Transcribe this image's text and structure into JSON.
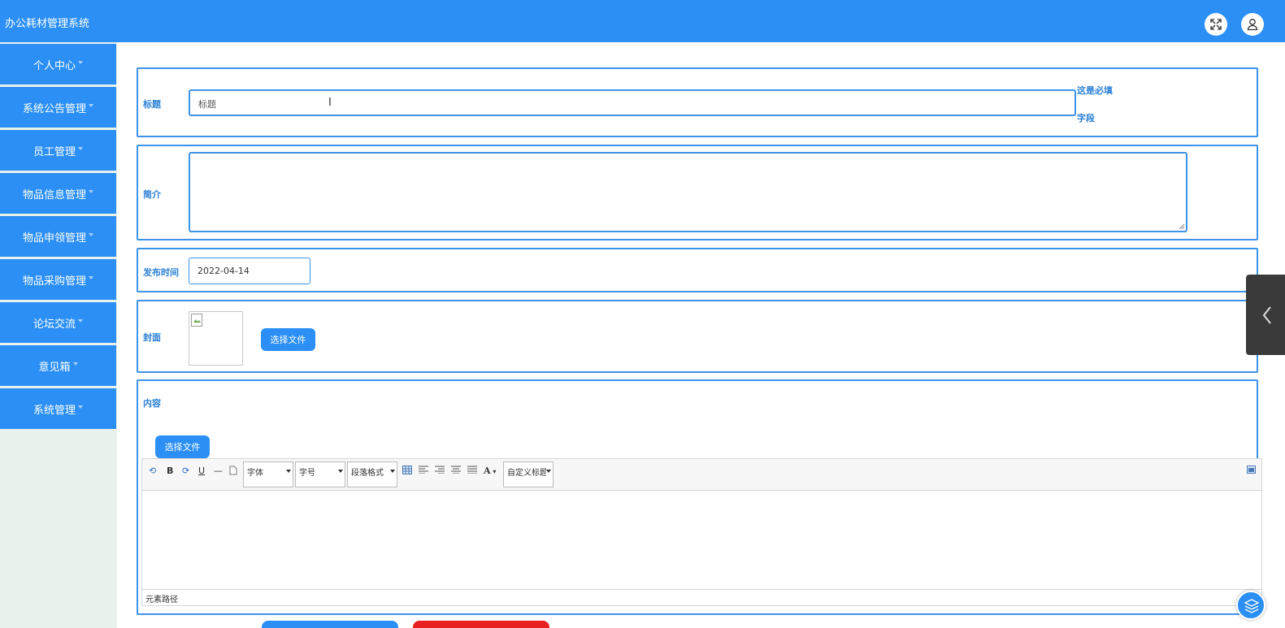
{
  "app": {
    "title": "办公耗材管理系统"
  },
  "header": {
    "fullscreen_icon": "expand-icon",
    "user_icon": "user-icon"
  },
  "sidebar": {
    "items": [
      {
        "label": "个人中心"
      },
      {
        "label": "系统公告管理"
      },
      {
        "label": "员工管理"
      },
      {
        "label": "物品信息管理"
      },
      {
        "label": "物品申领管理"
      },
      {
        "label": "物品采购管理"
      },
      {
        "label": "论坛交流"
      },
      {
        "label": "意见箱"
      },
      {
        "label": "系统管理"
      }
    ]
  },
  "form": {
    "title": {
      "label": "标题",
      "value": "标题",
      "required_line1": "这是必填",
      "required_line2": "字段"
    },
    "intro": {
      "label": "简介",
      "value": ""
    },
    "publish_time": {
      "label": "发布时间",
      "value": "2022-04-14"
    },
    "cover": {
      "label": "封面",
      "button": "选择文件"
    },
    "content": {
      "label": "内容",
      "button": "选择文件",
      "toolbar": {
        "font": "字体",
        "font_size": "字号",
        "paragraph": "段落格式",
        "custom_title": "自定义标题",
        "bold": "B",
        "underline": "U",
        "hr": "—",
        "font_color": "A"
      },
      "element_path": "元素路径"
    }
  },
  "colors": {
    "primary": "#2b8ff5",
    "border": "#3d93e8",
    "label": "#2a7fd6",
    "danger": "#e82020"
  }
}
